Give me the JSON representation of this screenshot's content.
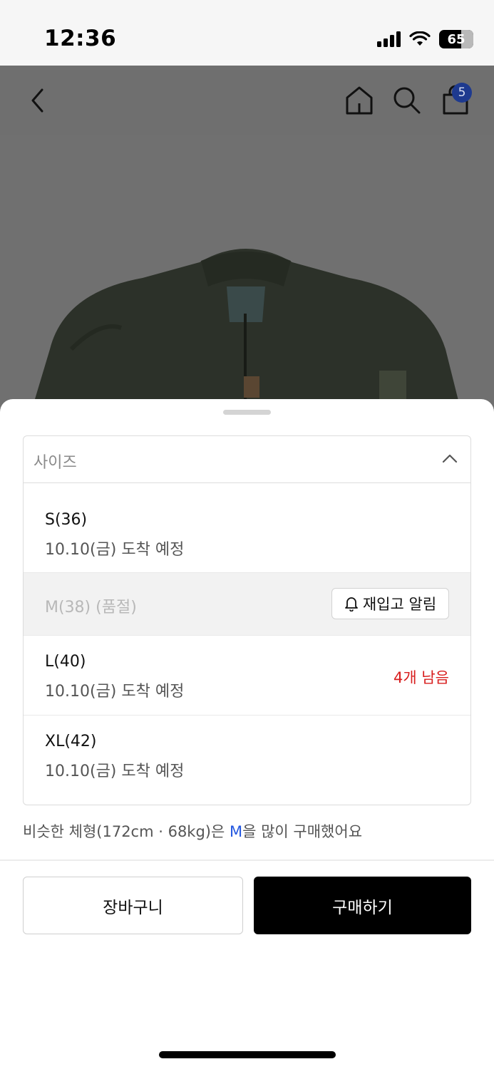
{
  "status_bar": {
    "time": "12:36",
    "battery_level": "65",
    "battery_fraction": 0.65
  },
  "nav": {
    "back_icon": "chevron-left-icon",
    "home_icon": "home-icon",
    "search_icon": "search-icon",
    "cart_icon": "shopping-bag-icon",
    "cart_count": "5"
  },
  "size_selector": {
    "placeholder": "사이즈",
    "expanded": true,
    "options": [
      {
        "label": "S(36)",
        "delivery": "10.10(금) 도착 예정",
        "sold_out": false
      },
      {
        "label": "M(38) (품절)",
        "sold_out": true,
        "restock_label": "재입고 알림"
      },
      {
        "label": "L(40)",
        "delivery": "10.10(금) 도착 예정",
        "stock_note": "4개 남음",
        "sold_out": false
      },
      {
        "label": "XL(42)",
        "delivery": "10.10(금) 도착 예정",
        "sold_out": false
      }
    ]
  },
  "recommendation": {
    "prefix": "비슷한 체형(172cm · 68kg)은 ",
    "highlight": "M",
    "suffix": "을 많이 구매했어요"
  },
  "actions": {
    "cart_label": "장바구니",
    "buy_label": "구매하기"
  },
  "colors": {
    "accent_blue": "#2357e0",
    "stock_red": "#d81e1e",
    "primary_button": "#000000",
    "badge_blue": "#1e3a8f"
  }
}
